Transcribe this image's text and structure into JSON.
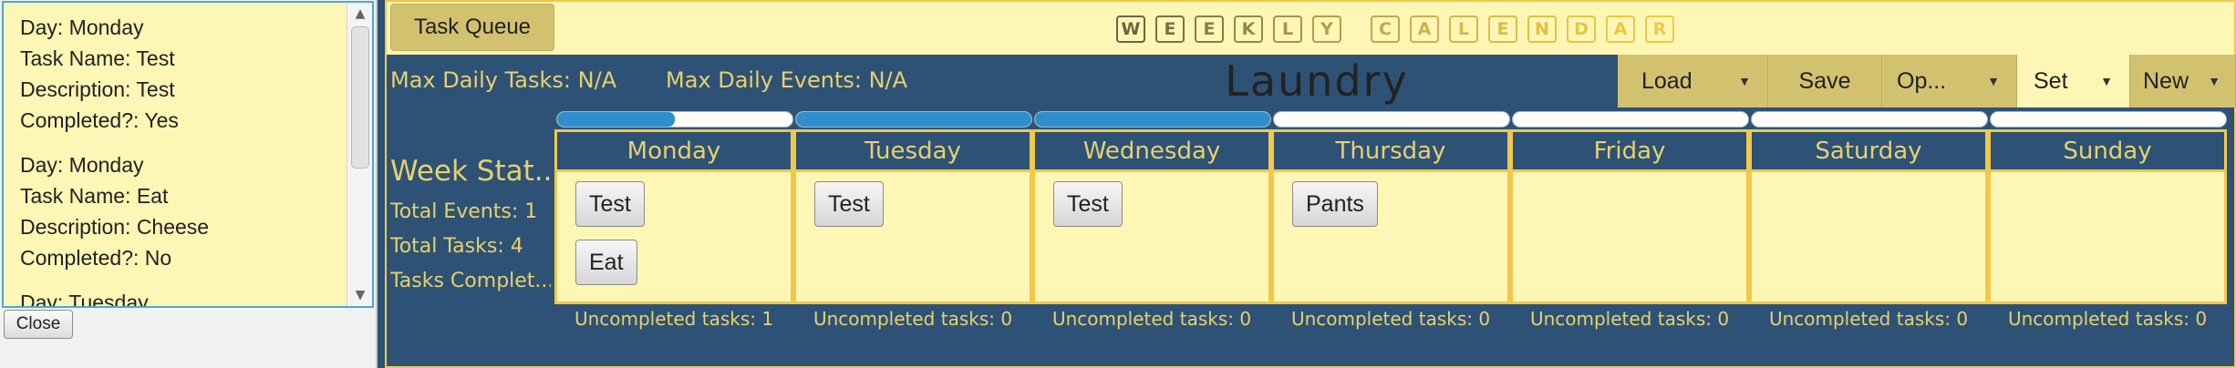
{
  "task_list": {
    "entries": [
      {
        "day": "Day: Monday",
        "name": "Task Name: Test",
        "description": "Description: Test",
        "completed": "Completed?:  Yes"
      },
      {
        "day": "Day: Monday",
        "name": "Task Name: Eat",
        "description": "Description: Cheese",
        "completed": "Completed?:  No"
      },
      {
        "day": "Day: Tuesday"
      }
    ],
    "close_label": "Close"
  },
  "header": {
    "task_queue_label": "Task Queue",
    "title_letters": [
      {
        "ch": "W",
        "color": "#6b6442"
      },
      {
        "ch": "E",
        "color": "#7a7048"
      },
      {
        "ch": "E",
        "color": "#8a7c4a"
      },
      {
        "ch": "K",
        "color": "#97874c"
      },
      {
        "ch": "L",
        "color": "#a6924e"
      },
      {
        "ch": "Y",
        "color": "#b49d4e"
      },
      {
        "ch": "C",
        "color": "#c2a84e",
        "gap": true
      },
      {
        "ch": "A",
        "color": "#cdb04c"
      },
      {
        "ch": "L",
        "color": "#d6b74a"
      },
      {
        "ch": "E",
        "color": "#ddbc48"
      },
      {
        "ch": "N",
        "color": "#e2c046"
      },
      {
        "ch": "D",
        "color": "#e6c444"
      },
      {
        "ch": "A",
        "color": "#eac842"
      },
      {
        "ch": "R",
        "color": "#edcb42"
      }
    ]
  },
  "info": {
    "max_daily_tasks": "Max Daily Tasks: N/A",
    "max_daily_events": "Max Daily Events: N/A",
    "calendar_name": "Laundry"
  },
  "toolbar": {
    "load_label": "Load",
    "save_label": "Save",
    "options_label": "Op...",
    "set_label": "Set",
    "new_label": "New"
  },
  "week_stats": {
    "title": "Week Stat...",
    "total_events": "Total Events:  1",
    "total_tasks": "Total Tasks:  4",
    "tasks_completed": "Tasks Complet..."
  },
  "days": [
    {
      "name": "Monday",
      "tasks": [
        "Test",
        "Eat"
      ],
      "uncompleted": "Uncompleted tasks:  1",
      "progress": 0.5
    },
    {
      "name": "Tuesday",
      "tasks": [
        "Test"
      ],
      "uncompleted": "Uncompleted tasks:  0",
      "progress": 1.0
    },
    {
      "name": "Wednesday",
      "tasks": [
        "Test"
      ],
      "uncompleted": "Uncompleted tasks:  0",
      "progress": 1.0
    },
    {
      "name": "Thursday",
      "tasks": [
        "Pants"
      ],
      "uncompleted": "Uncompleted tasks:  0",
      "progress": 0.0
    },
    {
      "name": "Friday",
      "tasks": [],
      "uncompleted": "Uncompleted tasks:  0",
      "progress": 0.0
    },
    {
      "name": "Saturday",
      "tasks": [],
      "uncompleted": "Uncompleted tasks:  0",
      "progress": 0.0
    },
    {
      "name": "Sunday",
      "tasks": [],
      "uncompleted": "Uncompleted tasks:  0",
      "progress": 0.0
    }
  ],
  "icons": {
    "scroll_up": "chevron-up-icon",
    "scroll_down": "chevron-down-icon",
    "dropdown": "chevron-down-icon"
  },
  "colors": {
    "panel_blue": "#2d5276",
    "cream": "#fdf6b4",
    "gold_text": "#e8d06c",
    "border_gold": "#f2c84b",
    "button_khaki": "#d2c270",
    "progress_blue": "#2f8fce"
  }
}
